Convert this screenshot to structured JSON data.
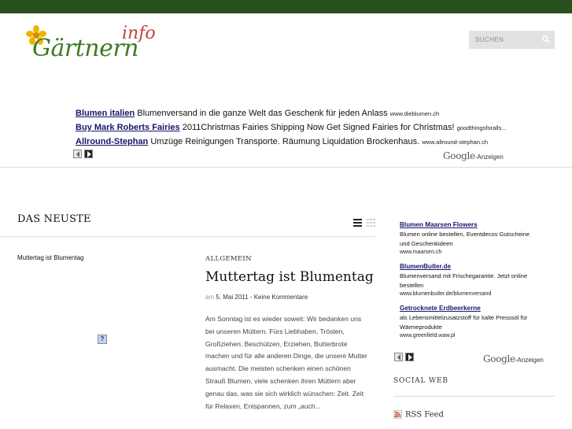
{
  "header": {
    "logo_word": "Gärtnern",
    "logo_suffix": "info",
    "search_placeholder": "SUCHEN"
  },
  "top_ads": [
    {
      "title": "Blumen italien",
      "desc": "Blumenversand in die ganze Welt das Geschenk für jeden Anlass",
      "url": "www.dieblumen.ch"
    },
    {
      "title": "Buy Mark Roberts Fairies",
      "desc": "2011Christmas Fairies Shipping Now Get Signed Fairies for Christmas!",
      "url": "goodthingsforalls..."
    },
    {
      "title": "Allround-Stephan",
      "desc": "Umzüge Reinigungen Transporte. Räumung Liquidation Brockenhaus.",
      "url": "www.allround-stephan.ch"
    }
  ],
  "google_ads_label": {
    "brand": "Google",
    "suffix": "-Anzeigen"
  },
  "main": {
    "section_title": "DAS NEUSTE",
    "post_small_title": "Muttertag ist Blumentag",
    "image_placeholder": "?",
    "post": {
      "category": "ALLGEMEIN",
      "title": "Muttertag ist Blumentag",
      "meta_prefix": "am",
      "date": "5. Mai 2011",
      "separator": " - ",
      "comments": "Keine Kommentare",
      "excerpt": "Am Sonntag ist es wieder soweit: Wir bedanken uns bei unseren Müttern. Fürs Liebhaben, Trösten, Großziehen, Beschützen, Erziehen, Butterbrote machen und für alle anderen Dinge, die unsere Mutter ausmacht. Die meisten schenken einen schönen Strauß Blumen, viele schenken ihren Müttern aber genau das, was sie sich wirklich wünschen: Zeit. Zeit für Relaxen, Entspannen, zum „auch..."
    }
  },
  "sidebar": {
    "ads": [
      {
        "title": "Blumen Maarsen Flowers",
        "desc": "Blumen online bestellen, Eventdecos Gutscheine und Geschenkideen",
        "url": "www.maarsen.ch"
      },
      {
        "title": "BlumenButler.de",
        "desc": "Blumenversand mit Frischegarantie. Jetzt online bestellen",
        "url": "www.blumenbutler.de/blumenversand"
      },
      {
        "title": "Getrocknete Erdbeerkerne",
        "desc": "als Lebensmittelzusatzstoff für kalte Presssöl für Wärmeprodukte",
        "url": "www.greenfield.waw.pl"
      }
    ],
    "social_title": "SOCIAL WEB",
    "rss_label": "RSS Feed"
  },
  "colors": {
    "topbar": "#27521d",
    "ad_link": "#16166e",
    "logo_green": "#3e7a23",
    "logo_red": "#c2433a"
  },
  "icons": [
    "flower-logo-icon",
    "search-icon",
    "list-view-icon",
    "grid-view-icon",
    "rss-icon",
    "chevron-left-icon",
    "chevron-right-icon"
  ]
}
